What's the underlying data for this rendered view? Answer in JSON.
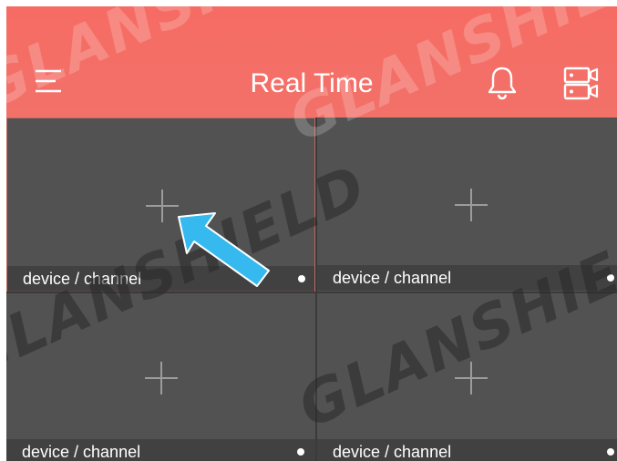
{
  "header": {
    "title": "Real Time",
    "menu_icon": "hamburger-menu-icon",
    "notification_icon": "bell-icon",
    "device_icon": "device-manager-icon",
    "background_color": "#f66c64"
  },
  "grid": {
    "cells": [
      {
        "label": "device / channel",
        "selected": true
      },
      {
        "label": "device / channel",
        "selected": false
      },
      {
        "label": "device / channel",
        "selected": false
      },
      {
        "label": "device / channel",
        "selected": false
      }
    ],
    "add_icon": "plus-icon",
    "status_icon": "status-dot-icon"
  },
  "watermark": {
    "text": "GLANSHIELD"
  },
  "annotation": {
    "arrow_color": "#35b9ee",
    "arrow_icon": "pointer-arrow-icon"
  }
}
